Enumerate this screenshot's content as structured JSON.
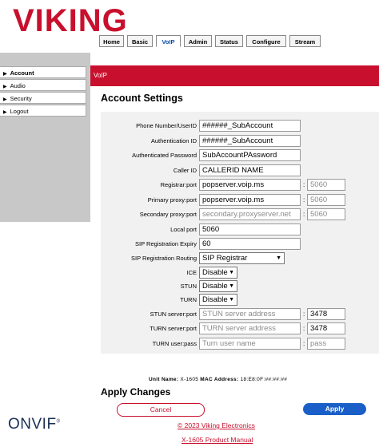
{
  "brand": {
    "logo_text": "VIKING",
    "logo_color": "#c8102e"
  },
  "tabs": [
    "Home",
    "Basic",
    "VoIP",
    "Admin",
    "Status",
    "Configure",
    "Stream"
  ],
  "active_tab": "VoIP",
  "sidebar": {
    "items": [
      "Account",
      "Audio",
      "Security",
      "Logout"
    ],
    "active": "Account"
  },
  "section_bar": "VoIP",
  "page_title": "Account Settings",
  "fields": {
    "phone_number": {
      "label": "Phone Number/UserID",
      "value": "######_SubAccount"
    },
    "auth_id": {
      "label": "Authentication ID",
      "value": "######_SubAccount"
    },
    "auth_password": {
      "label": "Authenticated Password",
      "value": "SubAccountPAssword"
    },
    "caller_id": {
      "label": "Caller ID",
      "value": "CALLERID NAME"
    },
    "registrar": {
      "label": "Registrar:port",
      "value": "popserver.voip.ms",
      "port_placeholder": "5060"
    },
    "primary_proxy": {
      "label": "Primary proxy:port",
      "value": "popserver.voip.ms",
      "port_placeholder": "5060"
    },
    "secondary_proxy": {
      "label": "Secondary proxy:port",
      "placeholder": "secondary.proxyserver.net",
      "port_placeholder": "5060"
    },
    "local_port": {
      "label": "Local port",
      "value": "5060"
    },
    "sip_expiry": {
      "label": "SIP Registration Expiry",
      "value": "60"
    },
    "sip_routing": {
      "label": "SIP Registration Routing",
      "value": "SIP Registrar"
    },
    "ice": {
      "label": "ICE",
      "value": "Disable"
    },
    "stun": {
      "label": "STUN",
      "value": "Disable"
    },
    "turn": {
      "label": "TURN",
      "value": "Disable"
    },
    "stun_server": {
      "label": "STUN server:port",
      "placeholder": "STUN server address",
      "port_value": "3478"
    },
    "turn_server": {
      "label": "TURN server:port",
      "placeholder": "TURN server address",
      "port_value": "3478"
    },
    "turn_user": {
      "label": "TURN user:pass",
      "placeholder": "Turn user name",
      "pass_placeholder": "pass"
    }
  },
  "unit_info": {
    "unit_label": "Unit Name:",
    "unit_value": "X-1605",
    "mac_label": "MAC Address:",
    "mac_value": "18:E8:0F:##:##:##"
  },
  "apply": {
    "title": "Apply Changes",
    "cancel": "Cancel",
    "apply": "Apply"
  },
  "footer": {
    "onvif": "ONVIF",
    "onvif_mark": "®",
    "copyright": "© 2023 Viking Electronics",
    "manual": "X-1605 Product Manual"
  },
  "colors": {
    "accent_red": "#c8102e",
    "apply_blue": "#1a5fc8",
    "panel_bg": "#f1f1f1",
    "sidebar_bg": "#c8c8c8"
  }
}
